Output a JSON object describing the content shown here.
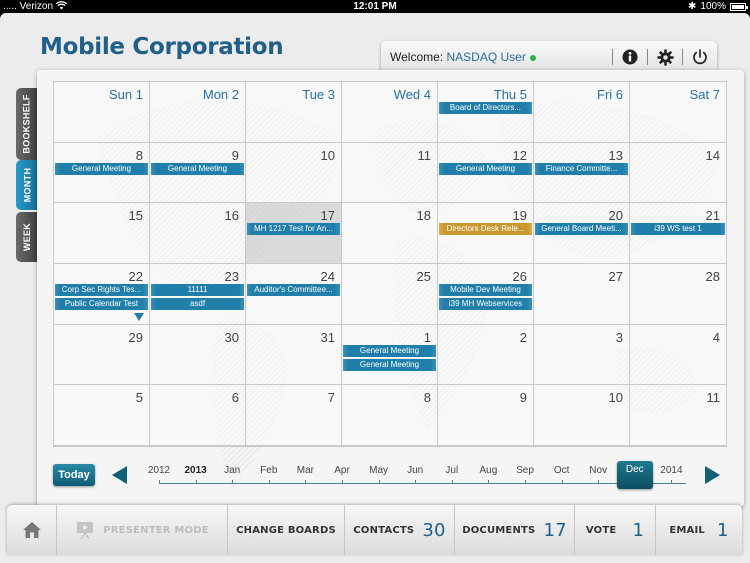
{
  "statusbar": {
    "carrier": "..... Verizon",
    "time": "12:01 PM",
    "battery": "100%"
  },
  "app": {
    "title": "Mobile Corporation"
  },
  "welcome": {
    "label": "Welcome:",
    "user": "NASDAQ User",
    "status_color": "#2bb34a",
    "icons": [
      "info-icon",
      "gear-icon",
      "power-icon"
    ]
  },
  "side_tabs": [
    {
      "label": "BOOKSHELF",
      "active": false
    },
    {
      "label": "MONTH",
      "active": true
    },
    {
      "label": "WEEK",
      "active": false
    }
  ],
  "calendar": {
    "weeks": [
      [
        {
          "label": "Sun 1",
          "header": true,
          "events": []
        },
        {
          "label": "Mon 2",
          "header": true,
          "events": []
        },
        {
          "label": "Tue 3",
          "header": true,
          "events": []
        },
        {
          "label": "Wed 4",
          "header": true,
          "events": []
        },
        {
          "label": "Thu 5",
          "header": true,
          "events": [
            {
              "title": "Board of Directors...",
              "color": "blue"
            }
          ]
        },
        {
          "label": "Fri 6",
          "header": true,
          "events": []
        },
        {
          "label": "Sat 7",
          "header": true,
          "events": []
        }
      ],
      [
        {
          "label": "8",
          "events": [
            {
              "title": "General Meeting",
              "color": "blue"
            }
          ]
        },
        {
          "label": "9",
          "events": [
            {
              "title": "General Meeting",
              "color": "blue"
            }
          ]
        },
        {
          "label": "10",
          "events": []
        },
        {
          "label": "11",
          "events": []
        },
        {
          "label": "12",
          "events": [
            {
              "title": "General Meeting",
              "color": "blue"
            }
          ]
        },
        {
          "label": "13",
          "events": [
            {
              "title": "Finance Committe...",
              "color": "blue"
            }
          ]
        },
        {
          "label": "14",
          "events": []
        }
      ],
      [
        {
          "label": "15",
          "events": []
        },
        {
          "label": "16",
          "events": []
        },
        {
          "label": "17",
          "today": true,
          "events": [
            {
              "title": "MH 1217 Test for An...",
              "color": "blue"
            }
          ]
        },
        {
          "label": "18",
          "events": []
        },
        {
          "label": "19",
          "events": [
            {
              "title": "Directors Desk Rele...",
              "color": "gold"
            }
          ]
        },
        {
          "label": "20",
          "events": [
            {
              "title": "General Board Meeti...",
              "color": "blue"
            }
          ]
        },
        {
          "label": "21",
          "events": [
            {
              "title": "i39 WS test 1",
              "color": "blue"
            }
          ]
        }
      ],
      [
        {
          "label": "22",
          "more": true,
          "events": [
            {
              "title": "Corp Sec Rights Tes...",
              "color": "blue"
            },
            {
              "title": "Public Calendar Test",
              "color": "blue"
            }
          ]
        },
        {
          "label": "23",
          "events": [
            {
              "title": "11111",
              "color": "blue"
            },
            {
              "title": "asdf",
              "color": "blue"
            }
          ]
        },
        {
          "label": "24",
          "events": [
            {
              "title": "Auditor's Committee...",
              "color": "blue"
            }
          ]
        },
        {
          "label": "25",
          "events": []
        },
        {
          "label": "26",
          "events": [
            {
              "title": "Mobile Dev Meeting",
              "color": "blue"
            },
            {
              "title": "i39 MH Webservices",
              "color": "blue"
            }
          ]
        },
        {
          "label": "27",
          "events": []
        },
        {
          "label": "28",
          "events": []
        }
      ],
      [
        {
          "label": "29",
          "events": []
        },
        {
          "label": "30",
          "events": []
        },
        {
          "label": "31",
          "events": []
        },
        {
          "label": "1",
          "events": [
            {
              "title": "General Meeting",
              "color": "blue"
            },
            {
              "title": "General Meeting",
              "color": "blue"
            }
          ]
        },
        {
          "label": "2",
          "events": []
        },
        {
          "label": "3",
          "events": []
        },
        {
          "label": "4",
          "events": []
        }
      ],
      [
        {
          "label": "5",
          "events": []
        },
        {
          "label": "6",
          "events": []
        },
        {
          "label": "7",
          "events": []
        },
        {
          "label": "8",
          "events": []
        },
        {
          "label": "9",
          "events": []
        },
        {
          "label": "10",
          "events": []
        },
        {
          "label": "11",
          "events": []
        }
      ]
    ],
    "colors": {
      "blue": "#1f7eaa",
      "gold": "#c9972f",
      "today_cell": "#d4d4d4"
    }
  },
  "timeline": {
    "today_label": "Today",
    "items": [
      {
        "label": "2012"
      },
      {
        "label": "2013",
        "bold": true
      },
      {
        "label": "Jan"
      },
      {
        "label": "Feb"
      },
      {
        "label": "Mar"
      },
      {
        "label": "Apr"
      },
      {
        "label": "May"
      },
      {
        "label": "Jun"
      },
      {
        "label": "Jul"
      },
      {
        "label": "Aug"
      },
      {
        "label": "Sep"
      },
      {
        "label": "Oct"
      },
      {
        "label": "Nov"
      },
      {
        "label": "Dec",
        "selected": true
      },
      {
        "label": "2014"
      }
    ]
  },
  "bottombar": {
    "home_icon": "home-icon",
    "presenter": {
      "label": "PRESENTER MODE",
      "icon": "presenter-icon",
      "disabled": true
    },
    "change_boards": {
      "label": "CHANGE BOARDS"
    },
    "contacts": {
      "label": "CONTACTS",
      "count": "30"
    },
    "documents": {
      "label": "DOCUMENTS",
      "count": "17"
    },
    "vote": {
      "label": "VOTE",
      "count": "1"
    },
    "email": {
      "label": "EMAIL",
      "count": "1"
    }
  }
}
